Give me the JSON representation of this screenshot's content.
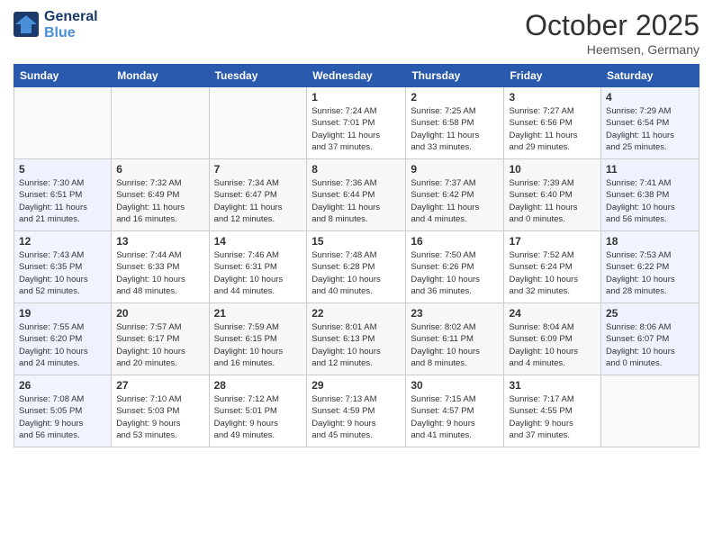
{
  "header": {
    "logo_line1": "General",
    "logo_line2": "Blue",
    "month": "October 2025",
    "location": "Heemsen, Germany"
  },
  "weekdays": [
    "Sunday",
    "Monday",
    "Tuesday",
    "Wednesday",
    "Thursday",
    "Friday",
    "Saturday"
  ],
  "weeks": [
    [
      {
        "day": "",
        "info": ""
      },
      {
        "day": "",
        "info": ""
      },
      {
        "day": "",
        "info": ""
      },
      {
        "day": "1",
        "info": "Sunrise: 7:24 AM\nSunset: 7:01 PM\nDaylight: 11 hours\nand 37 minutes."
      },
      {
        "day": "2",
        "info": "Sunrise: 7:25 AM\nSunset: 6:58 PM\nDaylight: 11 hours\nand 33 minutes."
      },
      {
        "day": "3",
        "info": "Sunrise: 7:27 AM\nSunset: 6:56 PM\nDaylight: 11 hours\nand 29 minutes."
      },
      {
        "day": "4",
        "info": "Sunrise: 7:29 AM\nSunset: 6:54 PM\nDaylight: 11 hours\nand 25 minutes."
      }
    ],
    [
      {
        "day": "5",
        "info": "Sunrise: 7:30 AM\nSunset: 6:51 PM\nDaylight: 11 hours\nand 21 minutes."
      },
      {
        "day": "6",
        "info": "Sunrise: 7:32 AM\nSunset: 6:49 PM\nDaylight: 11 hours\nand 16 minutes."
      },
      {
        "day": "7",
        "info": "Sunrise: 7:34 AM\nSunset: 6:47 PM\nDaylight: 11 hours\nand 12 minutes."
      },
      {
        "day": "8",
        "info": "Sunrise: 7:36 AM\nSunset: 6:44 PM\nDaylight: 11 hours\nand 8 minutes."
      },
      {
        "day": "9",
        "info": "Sunrise: 7:37 AM\nSunset: 6:42 PM\nDaylight: 11 hours\nand 4 minutes."
      },
      {
        "day": "10",
        "info": "Sunrise: 7:39 AM\nSunset: 6:40 PM\nDaylight: 11 hours\nand 0 minutes."
      },
      {
        "day": "11",
        "info": "Sunrise: 7:41 AM\nSunset: 6:38 PM\nDaylight: 10 hours\nand 56 minutes."
      }
    ],
    [
      {
        "day": "12",
        "info": "Sunrise: 7:43 AM\nSunset: 6:35 PM\nDaylight: 10 hours\nand 52 minutes."
      },
      {
        "day": "13",
        "info": "Sunrise: 7:44 AM\nSunset: 6:33 PM\nDaylight: 10 hours\nand 48 minutes."
      },
      {
        "day": "14",
        "info": "Sunrise: 7:46 AM\nSunset: 6:31 PM\nDaylight: 10 hours\nand 44 minutes."
      },
      {
        "day": "15",
        "info": "Sunrise: 7:48 AM\nSunset: 6:28 PM\nDaylight: 10 hours\nand 40 minutes."
      },
      {
        "day": "16",
        "info": "Sunrise: 7:50 AM\nSunset: 6:26 PM\nDaylight: 10 hours\nand 36 minutes."
      },
      {
        "day": "17",
        "info": "Sunrise: 7:52 AM\nSunset: 6:24 PM\nDaylight: 10 hours\nand 32 minutes."
      },
      {
        "day": "18",
        "info": "Sunrise: 7:53 AM\nSunset: 6:22 PM\nDaylight: 10 hours\nand 28 minutes."
      }
    ],
    [
      {
        "day": "19",
        "info": "Sunrise: 7:55 AM\nSunset: 6:20 PM\nDaylight: 10 hours\nand 24 minutes."
      },
      {
        "day": "20",
        "info": "Sunrise: 7:57 AM\nSunset: 6:17 PM\nDaylight: 10 hours\nand 20 minutes."
      },
      {
        "day": "21",
        "info": "Sunrise: 7:59 AM\nSunset: 6:15 PM\nDaylight: 10 hours\nand 16 minutes."
      },
      {
        "day": "22",
        "info": "Sunrise: 8:01 AM\nSunset: 6:13 PM\nDaylight: 10 hours\nand 12 minutes."
      },
      {
        "day": "23",
        "info": "Sunrise: 8:02 AM\nSunset: 6:11 PM\nDaylight: 10 hours\nand 8 minutes."
      },
      {
        "day": "24",
        "info": "Sunrise: 8:04 AM\nSunset: 6:09 PM\nDaylight: 10 hours\nand 4 minutes."
      },
      {
        "day": "25",
        "info": "Sunrise: 8:06 AM\nSunset: 6:07 PM\nDaylight: 10 hours\nand 0 minutes."
      }
    ],
    [
      {
        "day": "26",
        "info": "Sunrise: 7:08 AM\nSunset: 5:05 PM\nDaylight: 9 hours\nand 56 minutes."
      },
      {
        "day": "27",
        "info": "Sunrise: 7:10 AM\nSunset: 5:03 PM\nDaylight: 9 hours\nand 53 minutes."
      },
      {
        "day": "28",
        "info": "Sunrise: 7:12 AM\nSunset: 5:01 PM\nDaylight: 9 hours\nand 49 minutes."
      },
      {
        "day": "29",
        "info": "Sunrise: 7:13 AM\nSunset: 4:59 PM\nDaylight: 9 hours\nand 45 minutes."
      },
      {
        "day": "30",
        "info": "Sunrise: 7:15 AM\nSunset: 4:57 PM\nDaylight: 9 hours\nand 41 minutes."
      },
      {
        "day": "31",
        "info": "Sunrise: 7:17 AM\nSunset: 4:55 PM\nDaylight: 9 hours\nand 37 minutes."
      },
      {
        "day": "",
        "info": ""
      }
    ]
  ]
}
